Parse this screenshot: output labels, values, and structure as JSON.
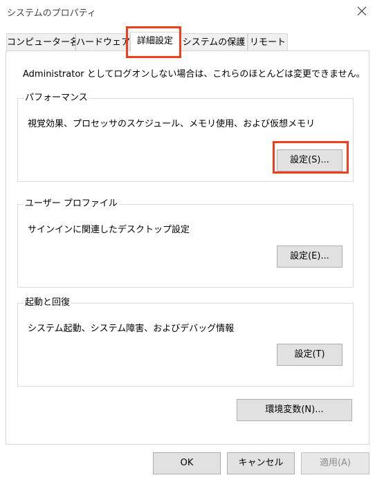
{
  "window": {
    "title": "システムのプロパティ"
  },
  "tabs": [
    {
      "label": "コンピューター名",
      "active": false
    },
    {
      "label": "ハードウェア",
      "active": false
    },
    {
      "label": "詳細設定",
      "active": true
    },
    {
      "label": "システムの保護",
      "active": false
    },
    {
      "label": "リモート",
      "active": false
    }
  ],
  "advanced": {
    "notice": "Administrator としてログオンしない場合は、これらのほとんどは変更できません。",
    "performance": {
      "legend": "パフォーマンス",
      "description": "視覚効果、プロセッサのスケジュール、メモリ使用、および仮想メモリ",
      "button": "設定(S)..."
    },
    "user_profile": {
      "legend": "ユーザー プロファイル",
      "description": "サインインに関連したデスクトップ設定",
      "button": "設定(E)..."
    },
    "startup_recovery": {
      "legend": "起動と回復",
      "description": "システム起動、システム障害、およびデバッグ情報",
      "button": "設定(T)"
    },
    "env_button": "環境変数(N)..."
  },
  "dialog_buttons": {
    "ok": "OK",
    "cancel": "キャンセル",
    "apply": "適用(A)"
  },
  "colors": {
    "highlight": "#f23d1a",
    "button_face": "#e1e1e1",
    "border": "#d6d6d6"
  },
  "icons": {
    "close": "close-icon"
  }
}
